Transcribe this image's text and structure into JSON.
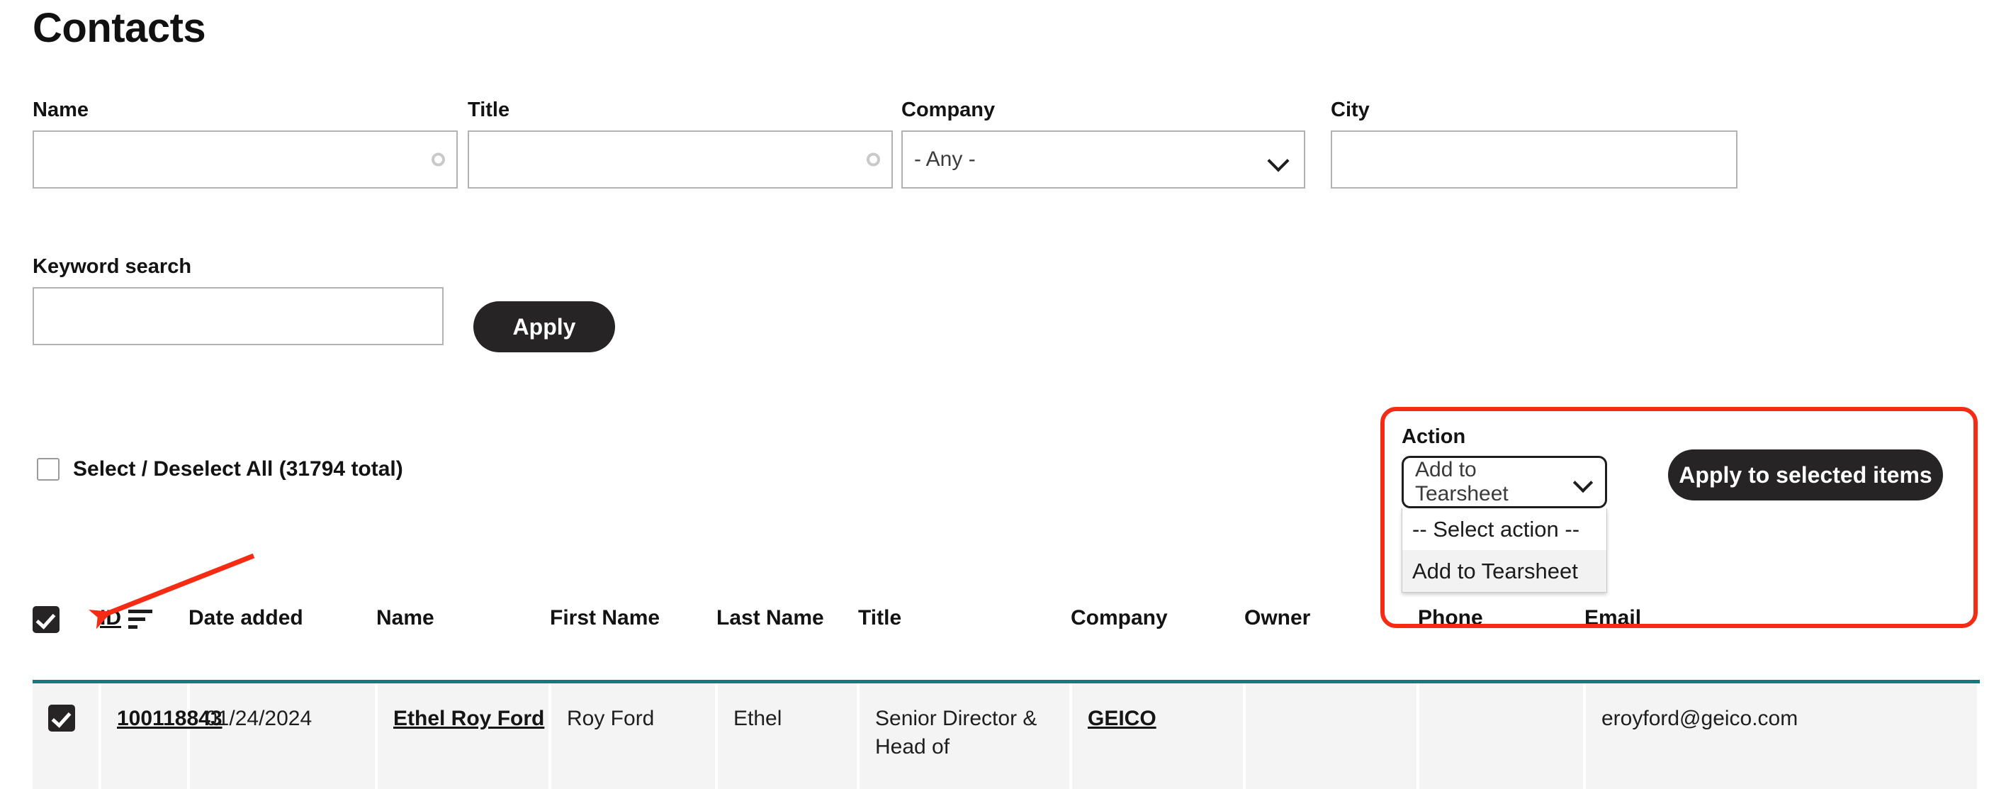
{
  "page": {
    "title": "Contacts"
  },
  "filters": {
    "fields": [
      {
        "label": "Name",
        "type": "text",
        "value": "",
        "placeholder": "",
        "icon": "throbber-icon"
      },
      {
        "label": "Title",
        "type": "text",
        "value": "",
        "placeholder": "",
        "icon": "throbber-icon"
      },
      {
        "label": "Company",
        "type": "select",
        "value": "- Any -",
        "icon": "chevron-down-icon"
      },
      {
        "label": "City",
        "type": "text",
        "value": "",
        "placeholder": ""
      }
    ],
    "keyword": {
      "label": "Keyword search",
      "value": "",
      "placeholder": ""
    },
    "apply_label": "Apply"
  },
  "bulk": {
    "select_all_label": "Select / Deselect All (31794 total)",
    "select_all_checked": false,
    "action_label": "Action",
    "action_selected": "Add to Tearsheet",
    "action_options": [
      {
        "label": "-- Select action --",
        "selected": false
      },
      {
        "label": "Add to Tearsheet",
        "selected": true
      }
    ],
    "apply_selected_label": "Apply to selected items"
  },
  "table": {
    "select_all_header_checked": true,
    "sort_column": "ID",
    "sort_icon": "sort-descending-icon",
    "columns": [
      "",
      "ID",
      "Date added",
      "Name",
      "First Name",
      "Last Name",
      "Title",
      "Company",
      "Owner",
      "Phone",
      "Email"
    ],
    "rows": [
      {
        "checked": true,
        "id": "100118843",
        "date_added": "01/24/2024",
        "name": "Ethel Roy Ford",
        "first_name": "Roy Ford",
        "last_name": "Ethel",
        "title": "Senior Director & Head of",
        "company": "GEICO",
        "owner": "",
        "phone": "",
        "email": "eroyford@geico.com"
      }
    ]
  },
  "annotations": {
    "highlight_color": "#f52b14",
    "arrow_color": "#f52b14",
    "target": "table-select-all-checkbox"
  },
  "colors": {
    "button_dark": "#262424",
    "table_accent": "#15797d",
    "row_background": "#f4f4f4"
  }
}
